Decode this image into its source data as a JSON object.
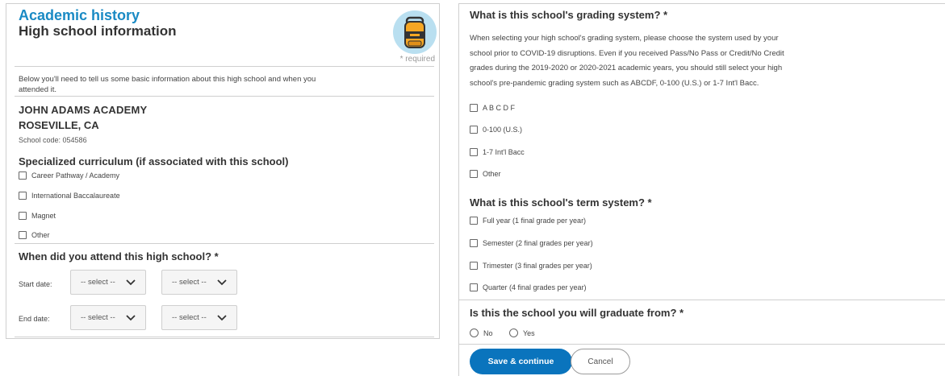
{
  "left": {
    "section_title": "Academic history",
    "heading": "High school information",
    "required_note": "* required",
    "info_text": "Below you'll need to tell us some basic information about this high school and when you attended it.",
    "school": {
      "name": "JOHN ADAMS ACADEMY",
      "location": "ROSEVILLE, CA",
      "code": "School code: 054586"
    },
    "curriculum": {
      "heading": "Specialized curriculum (if associated with this school)",
      "options": [
        "Career Pathway / Academy",
        "International Baccalaureate",
        "Magnet",
        "Other"
      ]
    },
    "attendance": {
      "heading": "When did you attend this high school? *",
      "start_label": "Start date:",
      "end_label": "End date:",
      "start_month": "-- select --",
      "start_year": "-- select --",
      "end_month": "-- select --",
      "end_year": "-- select --"
    }
  },
  "right": {
    "grading": {
      "question": "What is this school's grading system? *",
      "line1": "When selecting your high school's grading system, please choose the system used by your",
      "line2": "school prior to COVID-19 disruptions. Even if you received Pass/No Pass or Credit/No Credit",
      "line3": "grades during the 2019-2020 or 2020-2021 academic years, you should still select your high",
      "line4": "school's pre-pandemic grading system such as ABCDF, 0-100 (U.S.) or 1-7 Int'l Bacc.",
      "options": [
        "A B C D F",
        "0-100 (U.S.)",
        "1-7 Int'l Bacc",
        "Other"
      ]
    },
    "term": {
      "question": "What is this school's term system? *",
      "options": [
        "Full year (1 final grade per year)",
        "Semester (2 final grades per year)",
        "Trimester (3 final grades per year)",
        "Quarter (4 final grades per year)"
      ]
    },
    "graduate": {
      "question": "Is this the school you will graduate from? *",
      "no": "No",
      "yes": "Yes"
    },
    "save_label": "Save & continue",
    "cancel_label": "Cancel"
  },
  "colors": {
    "accent": "#1a8ac4",
    "button": "#0a74bd",
    "border": "#cfcfcf"
  },
  "icons": {
    "illustration": "backpack-icon",
    "dropdown": "chevron-down-icon"
  }
}
